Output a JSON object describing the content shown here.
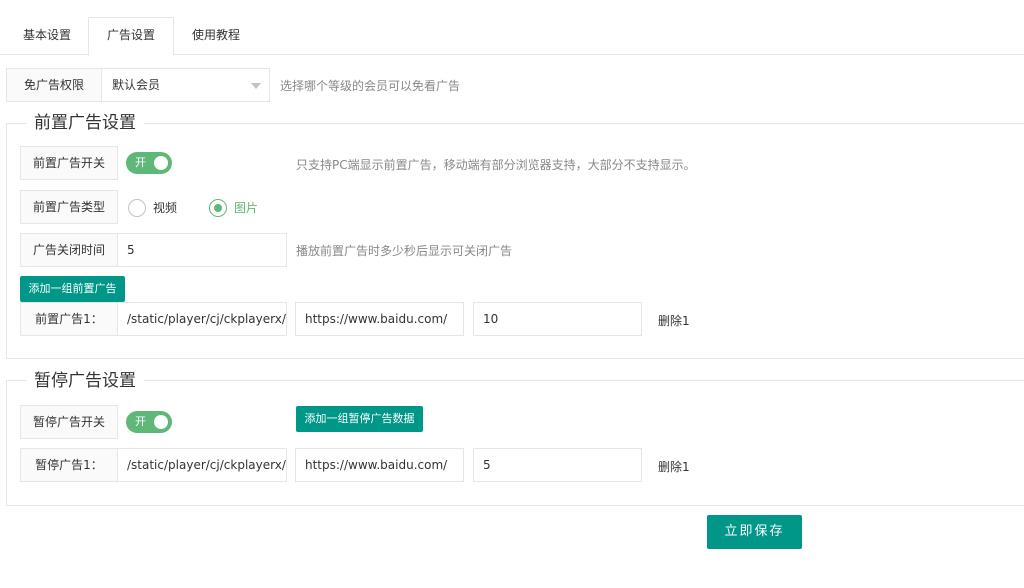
{
  "tabs": [
    {
      "label": "基本设置",
      "active": false
    },
    {
      "label": "广告设置",
      "active": true
    },
    {
      "label": "使用教程",
      "active": false
    }
  ],
  "free_ad": {
    "label": "免广告权限",
    "selected": "默认会员",
    "hint": "选择哪个等级的会员可以免看广告"
  },
  "pre_ad": {
    "legend": "前置广告设置",
    "switch_label": "前置广告开关",
    "switch_state": "开",
    "switch_hint": "只支持PC端显示前置广告，移动端有部分浏览器支持，大部分不支持显示。",
    "type_label": "前置广告类型",
    "type_options": [
      "视频",
      "图片"
    ],
    "type_selected": "图片",
    "close_time_label": "广告关闭时间",
    "close_time_value": "5",
    "close_time_hint": "播放前置广告时多少秒后显示可关闭广告",
    "add_button": "添加一组前置广告",
    "item": {
      "label": "前置广告1：",
      "path": "/static/player/cj/ckplayerx/",
      "url": "https://www.baidu.com/",
      "seconds": "10",
      "delete": "删除1"
    }
  },
  "pause_ad": {
    "legend": "暂停广告设置",
    "switch_label": "暂停广告开关",
    "switch_state": "开",
    "add_button": "添加一组暂停广告数据",
    "item": {
      "label": "暂停广告1：",
      "path": "/static/player/cj/ckplayerx/",
      "url": "https://www.baidu.com/",
      "seconds": "5",
      "delete": "删除1"
    }
  },
  "save_button": "立即保存",
  "colors": {
    "accent": "#009688",
    "switch_on": "#5fb878",
    "border": "#e6e6e6"
  }
}
